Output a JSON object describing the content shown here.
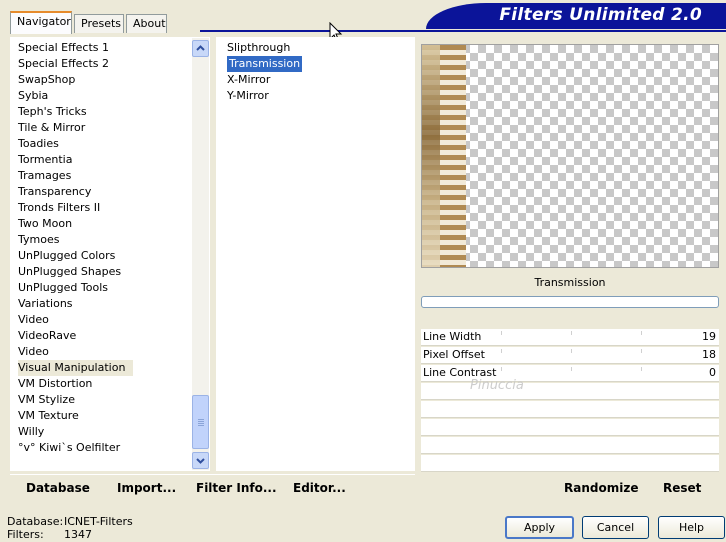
{
  "tabs": [
    {
      "label": "Navigator",
      "active": true
    },
    {
      "label": "Presets",
      "active": false
    },
    {
      "label": "About",
      "active": false
    }
  ],
  "banner_title": "Filters Unlimited 2.0",
  "categories": [
    "Special Effects 1",
    "Special Effects 2",
    "SwapShop",
    "Sybia",
    "Teph's Tricks",
    "Tile & Mirror",
    "Toadies",
    "Tormentia",
    "Tramages",
    "Transparency",
    "Tronds Filters II",
    "Two Moon",
    "Tymoes",
    "UnPlugged Colors",
    "UnPlugged Shapes",
    "UnPlugged Tools",
    "Variations",
    "Video",
    "VideoRave",
    "Video",
    "Visual Manipulation",
    "VM Distortion",
    "VM Stylize",
    "VM Texture",
    "Willy",
    "°v° Kiwi`s Oelfilter"
  ],
  "selected_category": "Visual Manipulation",
  "filters": [
    "Slipthrough",
    "Transmission",
    "X-Mirror",
    "Y-Mirror"
  ],
  "selected_filter": "Transmission",
  "preview_filter_name": "Transmission",
  "params": [
    {
      "label": "Line Width",
      "value": "19"
    },
    {
      "label": "Pixel Offset",
      "value": "18"
    },
    {
      "label": "Line Contrast",
      "value": "0"
    }
  ],
  "watermark": "Pinuccia",
  "toolbar": {
    "database": "Database",
    "import": "Import...",
    "filter_info": "Filter Info...",
    "editor": "Editor...",
    "randomize": "Randomize",
    "reset": "Reset"
  },
  "buttons": {
    "apply": "Apply",
    "cancel": "Cancel",
    "help": "Help"
  },
  "status": {
    "database_label": "Database:",
    "database_value": "ICNET-Filters",
    "filters_label": "Filters:",
    "filters_value": "1347"
  },
  "colors": {
    "banner": "#0b1499",
    "selection": "#316ac5",
    "tab_accent": "#e68b2c"
  }
}
